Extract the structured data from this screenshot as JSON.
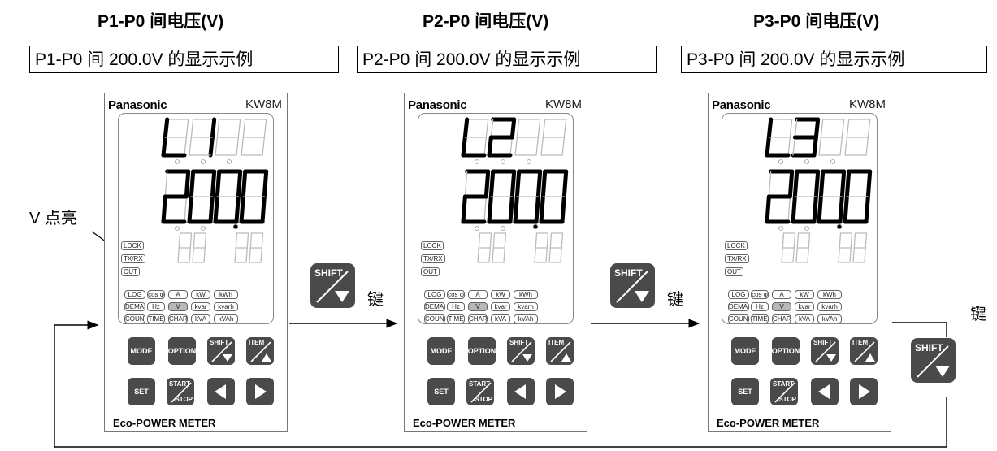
{
  "titles": [
    "P1-P0 间电压(V)",
    "P2-P0 间电压(V)",
    "P3-P0 间电压(V)"
  ],
  "examples": [
    "P1-P0 间 200.0V 的显示示例",
    "P2-P0 间 200.0V 的显示示例",
    "P3-P0 间 200.0V 的显示示例"
  ],
  "v_label": "V 点亮",
  "key_label": "键",
  "meter": {
    "brand": "Panasonic",
    "model": "KW8M",
    "footer": "Eco-POWER METER",
    "upper_digits": [
      "L1",
      "L2",
      "L3"
    ],
    "main_value": "200.0",
    "side_labels": [
      "LOCK",
      "TX/RX",
      "OUT"
    ],
    "unit_rows": [
      [
        "LOG",
        "cos φ",
        "A",
        "kW",
        "kWh"
      ],
      [
        "DEMAND",
        "Hz",
        "V",
        "kvar",
        "kvarh"
      ],
      [
        "COUNT",
        "TIME",
        "CHARGE",
        "kVA",
        "kVAh"
      ]
    ],
    "lit_unit": "V",
    "buttons": {
      "mode": "MODE",
      "option": "OPTION",
      "shift": "SHIFT",
      "item": "ITEM",
      "set": "SET",
      "start": "START",
      "stop": "STOP"
    }
  },
  "colors": {
    "button": "#4a4a4a",
    "lit": "#b8b8b8",
    "segment_off": "#bbbbbb",
    "segment_on": "#000000"
  }
}
